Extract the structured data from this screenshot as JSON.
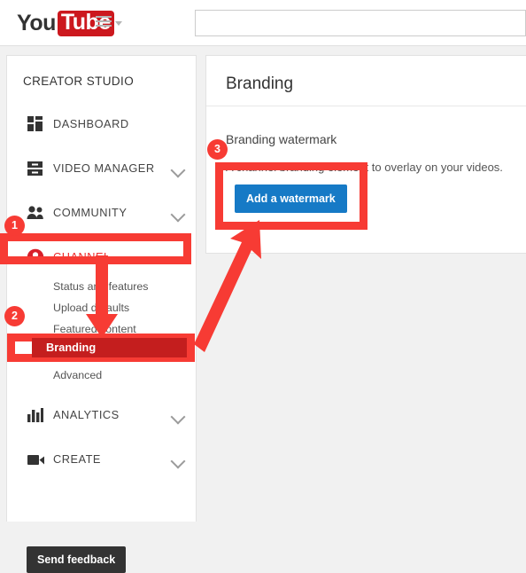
{
  "header": {
    "logo_you": "You",
    "logo_tube": "Tube",
    "guide_icon": "hamburger-menu-icon",
    "guide_caret_icon": "caret-down-icon",
    "search_value": "",
    "search_placeholder": ""
  },
  "sidebar": {
    "title": "CREATOR STUDIO",
    "items": [
      {
        "label": "DASHBOARD",
        "icon": "dashboard-icon",
        "expandable": false
      },
      {
        "label": "VIDEO MANAGER",
        "icon": "video-manager-icon",
        "expandable": true
      },
      {
        "label": "COMMUNITY",
        "icon": "community-people-icon",
        "expandable": true
      },
      {
        "label": "CHANNEL",
        "icon": "channel-person-icon",
        "expandable": false
      },
      {
        "label": "ANALYTICS",
        "icon": "analytics-bars-icon",
        "expandable": true
      },
      {
        "label": "CREATE",
        "icon": "create-camera-icon",
        "expandable": true
      }
    ],
    "channel_subitems": [
      {
        "label": "Status and features"
      },
      {
        "label": "Upload defaults"
      },
      {
        "label": "Featured content"
      },
      {
        "label": "Branding"
      },
      {
        "label": "Advanced"
      }
    ],
    "feedback_label": "Send feedback"
  },
  "main": {
    "page_title": "Branding",
    "section_heading": "Branding watermark",
    "section_description": "A channel branding element to overlay on your videos.",
    "add_watermark_label": "Add a watermark"
  },
  "annotations": {
    "badges": [
      {
        "number": "1"
      },
      {
        "number": "2"
      },
      {
        "number": "3"
      }
    ],
    "colors": {
      "highlight_red": "#f73b34",
      "branding_fill": "#c41e1e",
      "youtube_red": "#cc181e",
      "button_blue": "#167ac6",
      "dark_button": "#333333"
    }
  }
}
